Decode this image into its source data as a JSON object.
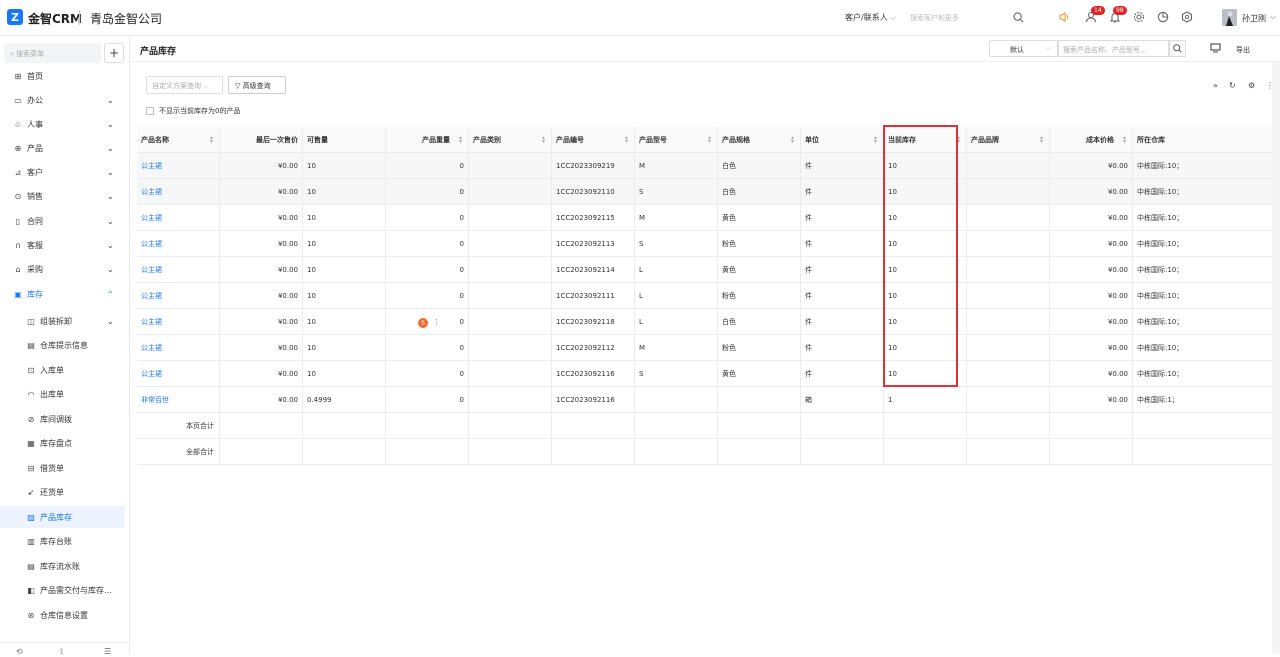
{
  "topbar": {
    "logo_mark": "Z",
    "logo": "金智CRM",
    "company": "青岛金智公司",
    "search_type": "客户/联系人",
    "search_placeholder": "搜索客户和更多",
    "badge_approvals": "14",
    "badge_notifications": "98",
    "username": "孙卫刚"
  },
  "sidebar": {
    "search_placeholder": "搜索菜单",
    "menu": [
      {
        "label": "首页",
        "icon": "home-icon",
        "glyph": "⊞"
      },
      {
        "label": "办公",
        "icon": "office-icon",
        "glyph": "▭",
        "chev": "⌄"
      },
      {
        "label": "人事",
        "icon": "hr-icon",
        "glyph": "♧",
        "chev": "⌄"
      },
      {
        "label": "产品",
        "icon": "product-icon",
        "glyph": "⊕",
        "chev": "⌄"
      },
      {
        "label": "客户",
        "icon": "customer-icon",
        "glyph": "⊿",
        "chev": "⌄"
      },
      {
        "label": "销售",
        "icon": "sales-icon",
        "glyph": "⊙",
        "chev": "⌄"
      },
      {
        "label": "合同",
        "icon": "contract-icon",
        "glyph": "▯",
        "chev": "⌄"
      },
      {
        "label": "客服",
        "icon": "service-icon",
        "glyph": "∩",
        "chev": "⌄"
      },
      {
        "label": "采购",
        "icon": "purchase-icon",
        "glyph": "⌂",
        "chev": "⌄"
      },
      {
        "label": "库存",
        "icon": "inventory-icon",
        "glyph": "▣",
        "chev": "⌃"
      }
    ],
    "submenu": [
      {
        "label": "组装拆卸",
        "icon": "assembly-icon",
        "glyph": "◫",
        "chev": "⌄"
      },
      {
        "label": "仓库提示信息",
        "icon": "warehouse-tip-icon",
        "glyph": "▤"
      },
      {
        "label": "入库单",
        "icon": "inbound-icon",
        "glyph": "⊡"
      },
      {
        "label": "出库单",
        "icon": "outbound-icon",
        "glyph": "◠"
      },
      {
        "label": "库间调拨",
        "icon": "transfer-icon",
        "glyph": "⊘"
      },
      {
        "label": "库存盘点",
        "icon": "stocktake-icon",
        "glyph": "▦"
      },
      {
        "label": "借货单",
        "icon": "borrow-icon",
        "glyph": "⊟"
      },
      {
        "label": "还货单",
        "icon": "return-icon",
        "glyph": "➹"
      },
      {
        "label": "产品库存",
        "icon": "product-stock-icon",
        "glyph": "▨",
        "active": true
      },
      {
        "label": "库存台账",
        "icon": "ledger-icon",
        "glyph": "▥"
      },
      {
        "label": "库存流水账",
        "icon": "journal-icon",
        "glyph": "▤"
      },
      {
        "label": "产品需交付与库存...",
        "icon": "delivery-icon",
        "glyph": "◧"
      },
      {
        "label": "仓库信息设置",
        "icon": "warehouse-settings-icon",
        "glyph": "⊛"
      }
    ]
  },
  "page": {
    "title": "产品库存",
    "view": "默认",
    "search_placeholder": "搜索产品名称、产品型号...",
    "export": "导出",
    "custom_query": "自定义方案查询",
    "advanced_query": "高级查询",
    "hide_zero_label": "不显示当前库存为0的产品"
  },
  "table": {
    "columns": [
      "产品名称",
      "最后一次售价",
      "可售量",
      "产品重量",
      "产品类别",
      "产品编号",
      "产品型号",
      "产品规格",
      "单位",
      "当前库存",
      "产品品牌",
      "成本价格",
      "所在仓库"
    ],
    "rows": [
      [
        "公主裙",
        "¥0.00",
        "10",
        "0",
        "",
        "1CC2023309219",
        "M",
        "白色",
        "件",
        "10",
        "",
        "¥0.00",
        "中栋国际:10；"
      ],
      [
        "公主裙",
        "¥0.00",
        "10",
        "0",
        "",
        "1CC2023092110",
        "S",
        "白色",
        "件",
        "10",
        "",
        "¥0.00",
        "中栋国际:10；"
      ],
      [
        "公主裙",
        "¥0.00",
        "10",
        "0",
        "",
        "1CC2023092115",
        "M",
        "黄色",
        "件",
        "10",
        "",
        "¥0.00",
        "中栋国际:10；"
      ],
      [
        "公主裙",
        "¥0.00",
        "10",
        "0",
        "",
        "1CC2023092113",
        "S",
        "粉色",
        "件",
        "10",
        "",
        "¥0.00",
        "中栋国际:10；"
      ],
      [
        "公主裙",
        "¥0.00",
        "10",
        "0",
        "",
        "1CC2023092114",
        "L",
        "黄色",
        "件",
        "10",
        "",
        "¥0.00",
        "中栋国际:10；"
      ],
      [
        "公主裙",
        "¥0.00",
        "10",
        "0",
        "",
        "1CC2023092111",
        "L",
        "粉色",
        "件",
        "10",
        "",
        "¥0.00",
        "中栋国际:10；"
      ],
      [
        "公主裙",
        "¥0.00",
        "10",
        "0",
        "",
        "1CC2023092118",
        "L",
        "白色",
        "件",
        "10",
        "",
        "¥0.00",
        "中栋国际:10；"
      ],
      [
        "公主裙",
        "¥0.00",
        "10",
        "0",
        "",
        "1CC2023092112",
        "M",
        "粉色",
        "件",
        "10",
        "",
        "¥0.00",
        "中栋国际:10；"
      ],
      [
        "公主裙",
        "¥0.00",
        "10",
        "0",
        "",
        "1CC2023092116",
        "S",
        "黄色",
        "件",
        "10",
        "",
        "¥0.00",
        "中栋国际:10；"
      ],
      [
        "非常百世",
        "¥0.00",
        "0.4999",
        "0",
        "",
        "1CC2023092116",
        "",
        "",
        "箱",
        "1",
        "",
        "¥0.00",
        "中栋国际:1；"
      ]
    ],
    "page_total_label": "本页合计",
    "all_total_label": "全部合计"
  },
  "colors": {
    "accent": "#1677ff",
    "highlight_box": "#e0303a",
    "badge": "#e02424"
  }
}
